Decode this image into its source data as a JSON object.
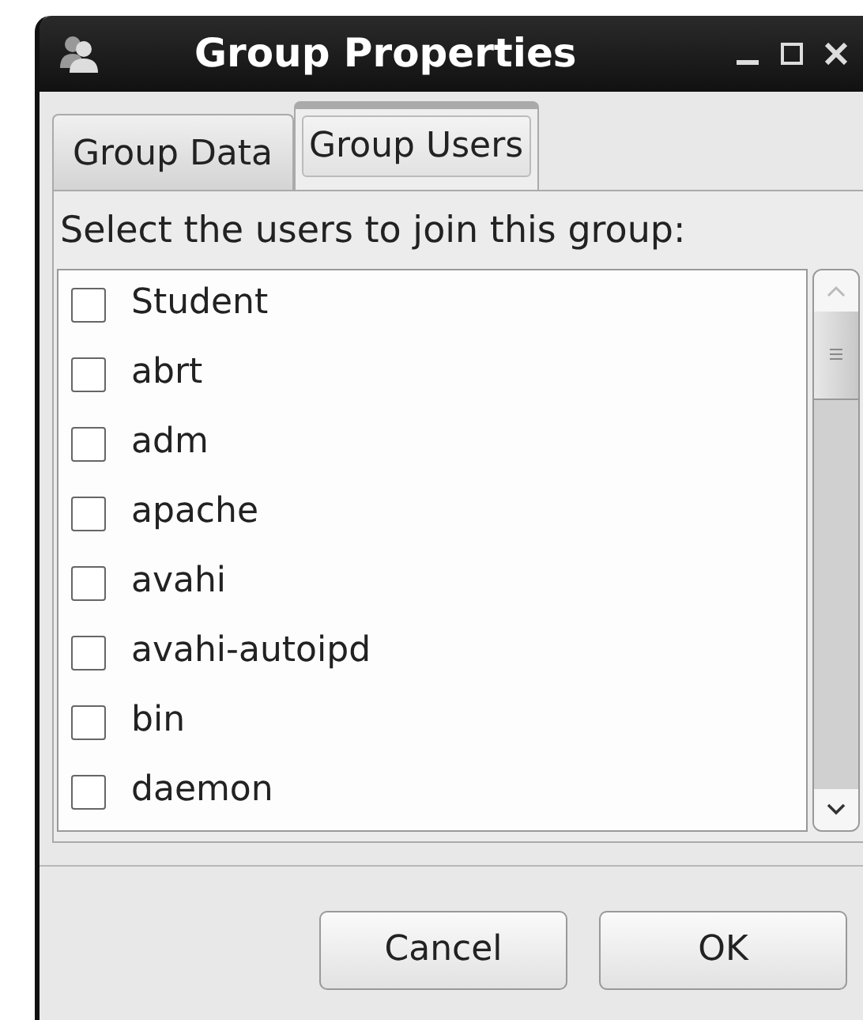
{
  "window": {
    "title": "Group Properties"
  },
  "tabs": [
    {
      "label": "Group Data",
      "selected": false
    },
    {
      "label": "Group Users",
      "selected": true
    }
  ],
  "prompt": "Select the users to join this group:",
  "users": [
    {
      "name": "Student",
      "checked": false
    },
    {
      "name": "abrt",
      "checked": false
    },
    {
      "name": "adm",
      "checked": false
    },
    {
      "name": "apache",
      "checked": false
    },
    {
      "name": "avahi",
      "checked": false
    },
    {
      "name": "avahi-autoipd",
      "checked": false
    },
    {
      "name": "bin",
      "checked": false
    },
    {
      "name": "daemon",
      "checked": false
    }
  ],
  "buttons": [
    {
      "label": "Cancel"
    },
    {
      "label": "OK"
    }
  ]
}
